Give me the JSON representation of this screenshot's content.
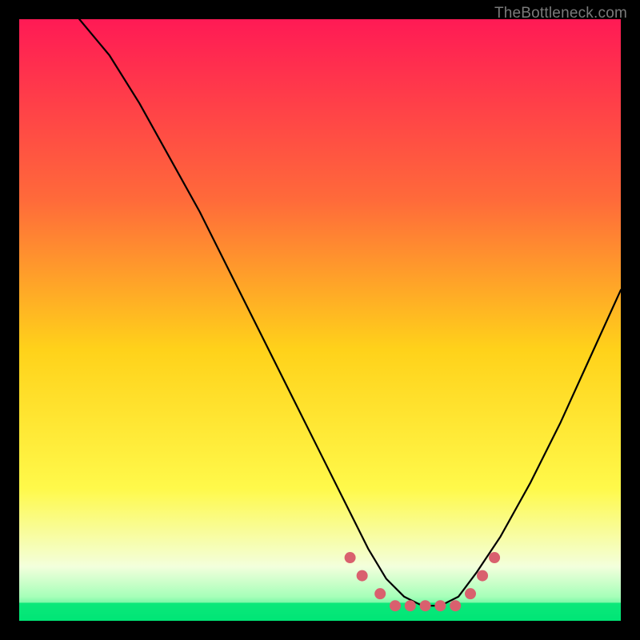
{
  "watermark": "TheBottleneck.com",
  "chart_data": {
    "type": "line",
    "title": "",
    "xlabel": "",
    "ylabel": "",
    "xlim": [
      0,
      100
    ],
    "ylim": [
      0,
      100
    ],
    "background_gradient_stops": [
      {
        "offset": 0.0,
        "color": "#ff1a55"
      },
      {
        "offset": 0.3,
        "color": "#ff6a3a"
      },
      {
        "offset": 0.55,
        "color": "#ffd21a"
      },
      {
        "offset": 0.78,
        "color": "#fff94a"
      },
      {
        "offset": 0.91,
        "color": "#f3ffdc"
      },
      {
        "offset": 0.96,
        "color": "#a6ffb9"
      },
      {
        "offset": 1.0,
        "color": "#00e676"
      }
    ],
    "series": [
      {
        "name": "bottleneck-curve",
        "color": "#000000",
        "x": [
          10,
          15,
          20,
          25,
          30,
          35,
          40,
          45,
          50,
          55,
          58,
          61,
          64,
          67,
          70,
          73,
          76,
          80,
          85,
          90,
          95,
          100
        ],
        "y": [
          100,
          94,
          86,
          77,
          68,
          58,
          48,
          38,
          28,
          18,
          12,
          7,
          4,
          2.5,
          2.5,
          4,
          8,
          14,
          23,
          33,
          44,
          55
        ]
      }
    ],
    "markers": {
      "name": "highlighted-points",
      "color": "#d9606e",
      "radius": 7,
      "points": [
        {
          "x": 55.0,
          "y": 10.5
        },
        {
          "x": 57.0,
          "y": 7.5
        },
        {
          "x": 60.0,
          "y": 4.5
        },
        {
          "x": 62.5,
          "y": 2.5
        },
        {
          "x": 65.0,
          "y": 2.5
        },
        {
          "x": 67.5,
          "y": 2.5
        },
        {
          "x": 70.0,
          "y": 2.5
        },
        {
          "x": 72.5,
          "y": 2.5
        },
        {
          "x": 75.0,
          "y": 4.5
        },
        {
          "x": 77.0,
          "y": 7.5
        },
        {
          "x": 79.0,
          "y": 10.5
        }
      ]
    },
    "green_band": {
      "x0": 0,
      "x1": 100,
      "y0": 0,
      "y1": 3
    }
  }
}
